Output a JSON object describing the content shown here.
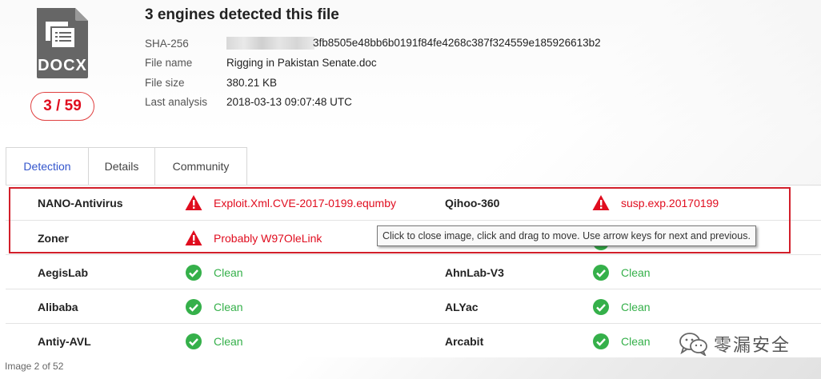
{
  "file": {
    "type_label": "DOCX",
    "score": "3 / 59",
    "title": "3 engines detected this file",
    "meta": [
      {
        "key": "SHA-256",
        "value": "3fb8505e48bb6b0191f84fe4268c387f324559e185926613b2"
      },
      {
        "key": "File name",
        "value": "Rigging in Pakistan Senate.doc"
      },
      {
        "key": "File size",
        "value": "380.21 KB"
      },
      {
        "key": "Last analysis",
        "value": "2018-03-13 09:07:48 UTC"
      }
    ]
  },
  "tabs": [
    "Detection",
    "Details",
    "Community"
  ],
  "detections": [
    {
      "left_engine": "NANO-Antivirus",
      "left_result": "Exploit.Xml.CVE-2017-0199.equmby",
      "left_status": "malicious",
      "right_engine": "Qihoo-360",
      "right_result": "susp.exp.20170199",
      "right_status": "malicious"
    },
    {
      "left_engine": "Zoner",
      "left_result": "Probably W97OleLink",
      "left_status": "malicious",
      "right_engine": "",
      "right_result": "",
      "right_status": "hidden"
    },
    {
      "left_engine": "AegisLab",
      "left_result": "Clean",
      "left_status": "clean",
      "right_engine": "AhnLab-V3",
      "right_result": "Clean",
      "right_status": "clean"
    },
    {
      "left_engine": "Alibaba",
      "left_result": "Clean",
      "left_status": "clean",
      "right_engine": "ALYac",
      "right_result": "Clean",
      "right_status": "clean"
    },
    {
      "left_engine": "Antiy-AVL",
      "left_result": "Clean",
      "left_status": "clean",
      "right_engine": "Arcabit",
      "right_result": "Clean",
      "right_status": "clean"
    }
  ],
  "tooltip": "Click to close image, click and drag to move. Use arrow keys for next and previous.",
  "image_counter": "Image 2 of 52",
  "watermark": "零漏安全",
  "colors": {
    "malicious": "#e00d1f",
    "clean": "#35b04a",
    "accent": "#3355cc",
    "highlight_border": "#d21f2a"
  }
}
